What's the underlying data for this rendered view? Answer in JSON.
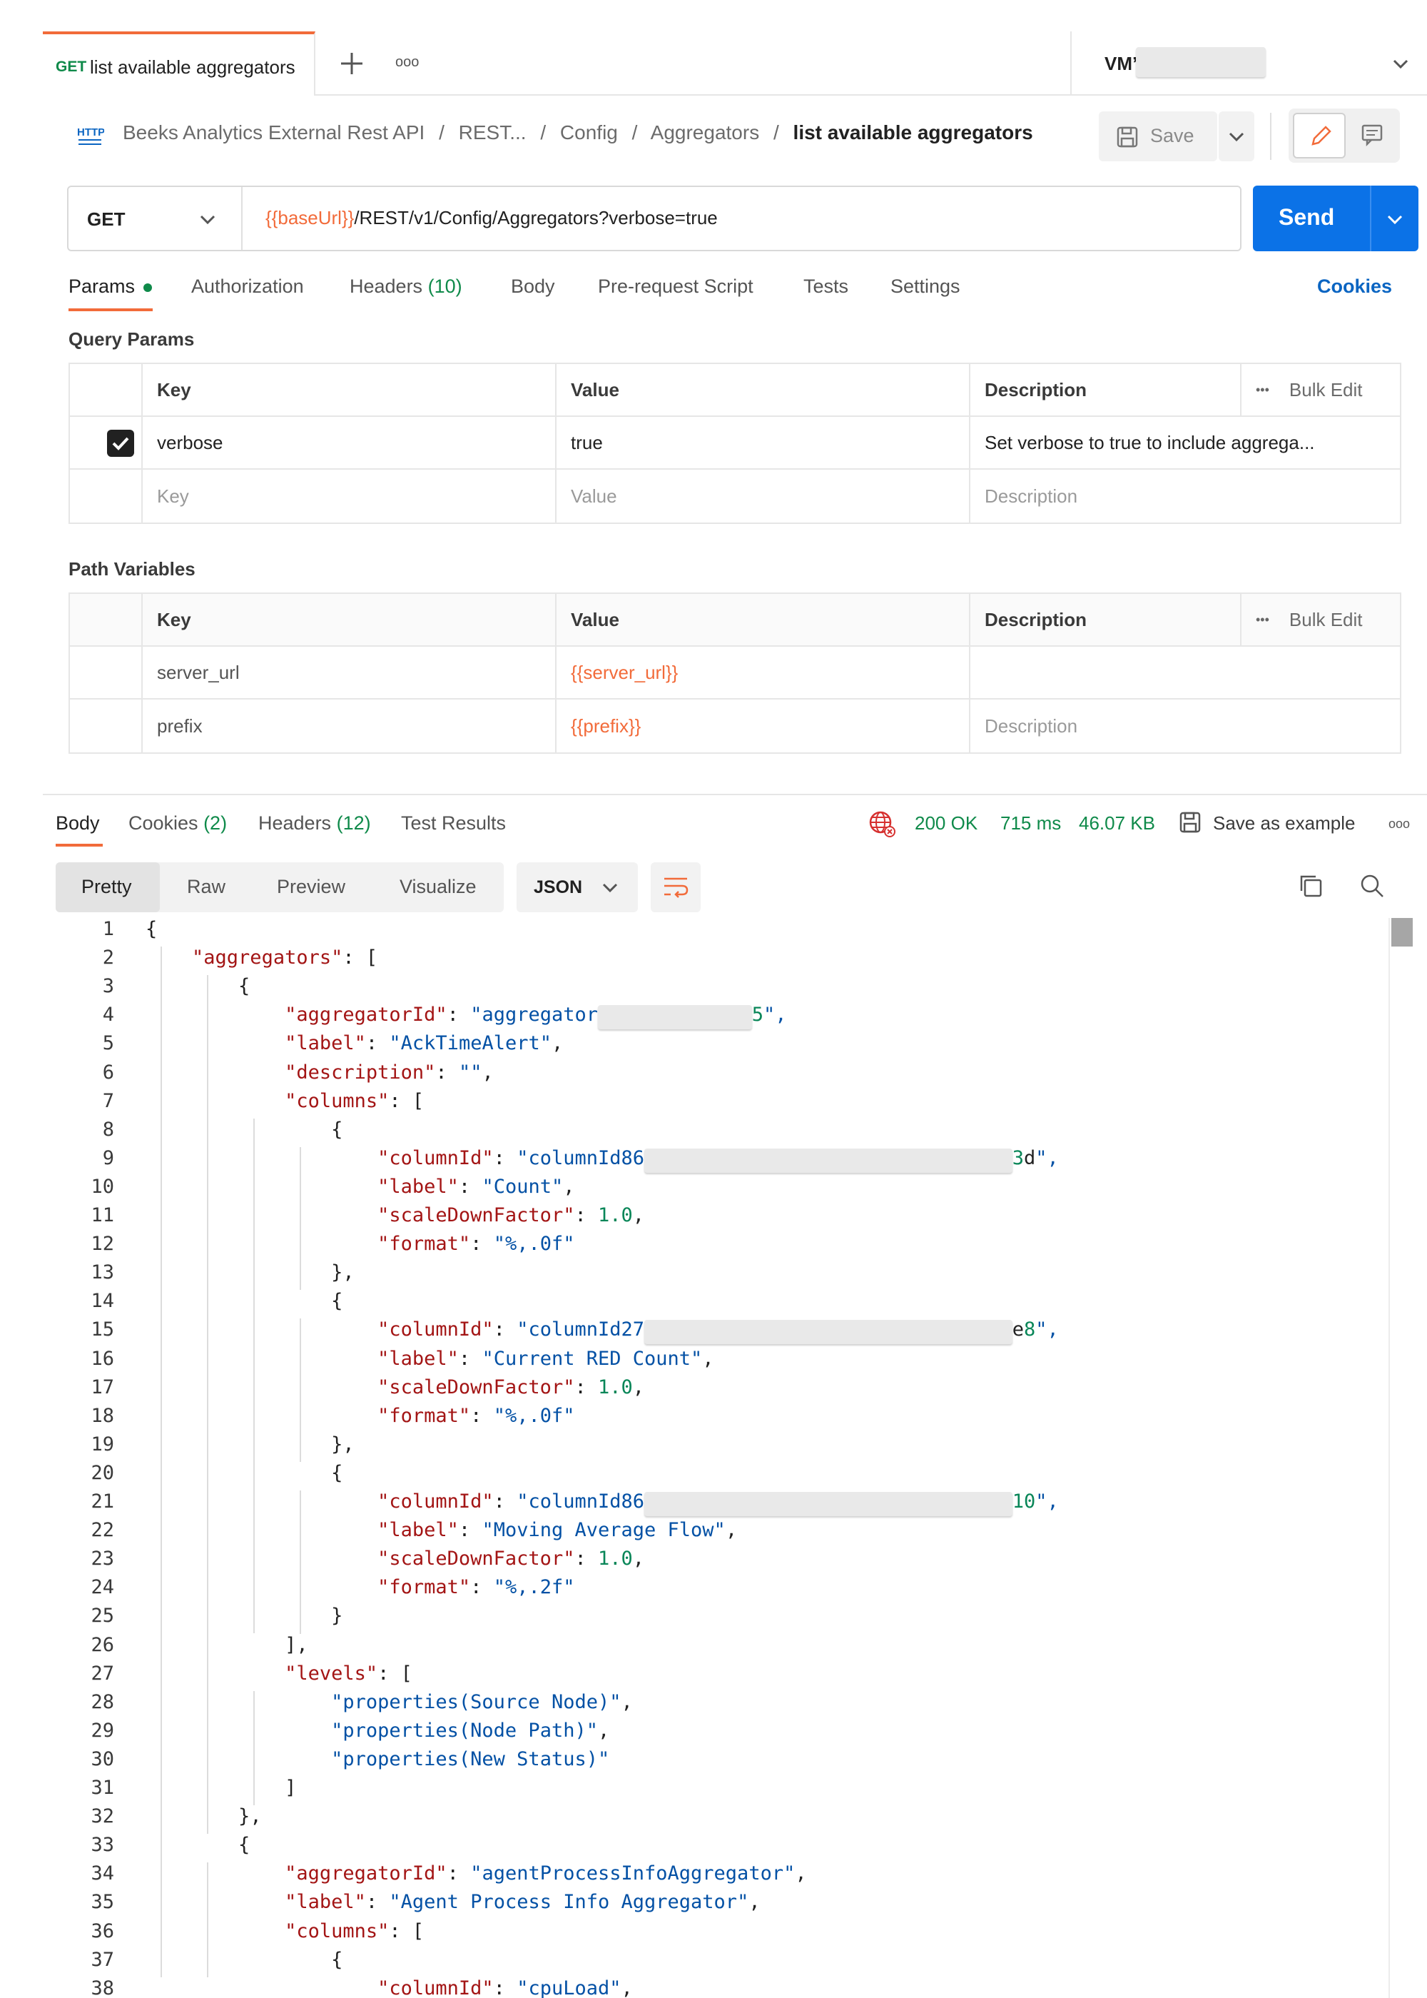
{
  "tab": {
    "method": "GET",
    "name": "list available aggregators",
    "more_glyph": "ooo",
    "env_label": "VM’"
  },
  "breadcrumb": {
    "http_icon_label": "HTTP",
    "items": [
      "Beeks Analytics External Rest API",
      "/",
      "REST...",
      "/",
      "Config",
      "/",
      "Aggregators",
      "/"
    ],
    "current": "list available aggregators",
    "save_label": "Save"
  },
  "request": {
    "method": "GET",
    "url_var": "{{baseUrl}}",
    "url_rest": "/REST/v1/Config/Aggregators?verbose=true",
    "send_label": "Send"
  },
  "request_tabs": {
    "params": "Params",
    "authorization": "Authorization",
    "headers": "Headers",
    "headers_count": "(10)",
    "body": "Body",
    "prerequest": "Pre-request Script",
    "tests": "Tests",
    "settings": "Settings",
    "cookies": "Cookies"
  },
  "query_params": {
    "title": "Query Params",
    "columns": [
      "Key",
      "Value",
      "Description"
    ],
    "bulk_edit": "Bulk Edit",
    "more_glyph": "•••",
    "rows": [
      {
        "key": "verbose",
        "value": "true",
        "description": "Set verbose to true to include aggrega..."
      }
    ],
    "placeholder": {
      "key": "Key",
      "value": "Value",
      "description": "Description"
    }
  },
  "path_variables": {
    "title": "Path Variables",
    "columns": [
      "Key",
      "Value",
      "Description"
    ],
    "bulk_edit": "Bulk Edit",
    "more_glyph": "•••",
    "rows": [
      {
        "key": "server_url",
        "value": "{{server_url}}",
        "description": ""
      },
      {
        "key": "prefix",
        "value": "{{prefix}}",
        "description": "Description"
      }
    ]
  },
  "response": {
    "tabs": {
      "body": "Body",
      "cookies": "Cookies",
      "cookies_count": "(2)",
      "headers": "Headers",
      "headers_count": "(12)",
      "test_results": "Test Results"
    },
    "status": "200 OK",
    "time": "715 ms",
    "size": "46.07 KB",
    "save_example": "Save as example",
    "more_glyph": "ooo",
    "views": [
      "Pretty",
      "Raw",
      "Preview",
      "Visualize"
    ],
    "format": "JSON"
  },
  "colors": {
    "accent_orange": "#f26b3a",
    "send_blue": "#0b72e7",
    "success_green": "#0f8a4a",
    "json_key": "#a31515",
    "json_string": "#0451a5",
    "json_number": "#098658"
  },
  "code_lines": [
    "{",
    "    \"aggregators\": [",
    "        {",
    "            \"aggregatorId\": \"aggregator",
    "            \"label\": \"AckTimeAlert\",",
    "            \"description\": \"\",",
    "            \"columns\": [",
    "                {",
    "                    \"columnId\": \"columnId86",
    "                    \"label\": \"Count\",",
    "                    \"scaleDownFactor\": 1.0,",
    "                    \"format\": \"%,.0f\"",
    "                },",
    "                {",
    "                    \"columnId\": \"columnId27",
    "                    \"label\": \"Current RED Count\",",
    "                    \"scaleDownFactor\": 1.0,",
    "                    \"format\": \"%,.0f\"",
    "                },",
    "                {",
    "                    \"columnId\": \"columnId86",
    "                    \"label\": \"Moving Average Flow\",",
    "                    \"scaleDownFactor\": 1.0,",
    "                    \"format\": \"%,.2f\"",
    "                }",
    "            ],",
    "            \"levels\": [",
    "                \"properties(Source Node)\",",
    "                \"properties(Node Path)\",",
    "                \"properties(New Status)\"",
    "            ]",
    "        },",
    "        {",
    "            \"aggregatorId\": \"agentProcessInfoAggregator\",",
    "            \"label\": \"Agent Process Info Aggregator\",",
    "            \"columns\": [",
    "                {",
    "                    \"columnId\": \"cpuLoad\","
  ],
  "redacted_tails": {
    "line4": "5\",",
    "line9": "3d\",",
    "line15": "e8\",",
    "line21": "10\","
  }
}
